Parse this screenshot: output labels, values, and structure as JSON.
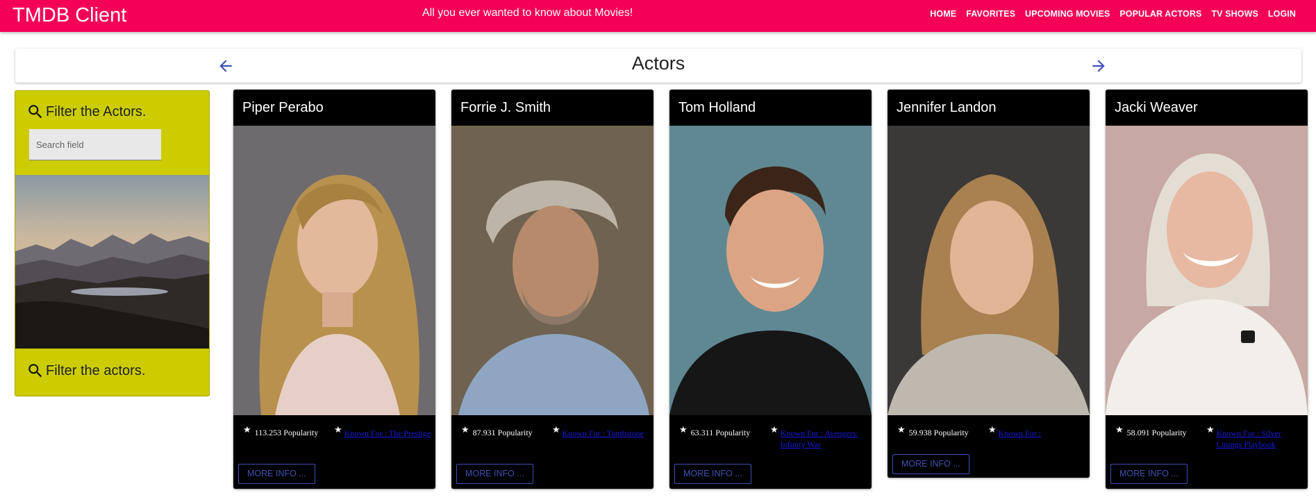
{
  "appbar": {
    "title": "TMDB Client",
    "tagline": "All you ever wanted to know about Movies!",
    "nav": [
      "HOME",
      "FAVORITES",
      "UPCOMING MOVIES",
      "POPULAR ACTORS",
      "TV SHOWS",
      "LOGIN"
    ],
    "color": "#f50057"
  },
  "header": {
    "title": "Actors",
    "prev_icon": "arrow-left-icon",
    "next_icon": "arrow-right-icon"
  },
  "filter": {
    "heading_top": "Filter the Actors.",
    "search_placeholder": "Search field",
    "heading_bottom": "Filter the actors.",
    "color": "#cccc00"
  },
  "actors": [
    {
      "name": "Piper Perabo",
      "popularity": "113.253 Popularity",
      "known_for": "Known For : The Prestige",
      "more": "MORE INFO ..."
    },
    {
      "name": "Forrie J. Smith",
      "popularity": "87.931 Popularity",
      "known_for": "Known For : Tombstone",
      "more": "MORE INFO ..."
    },
    {
      "name": "Tom Holland",
      "popularity": "63.311 Popularity",
      "known_for": "Known For : Avengers: Infinity War",
      "more": "MORE INFO ..."
    },
    {
      "name": "Jennifer Landon",
      "popularity": "59.938 Popularity",
      "known_for": "Known For :",
      "more": "MORE INFO ..."
    },
    {
      "name": "Jacki Weaver",
      "popularity": "58.091 Popularity",
      "known_for": "Known For : Silver Linings Playbook",
      "more": "MORE INFO ..."
    }
  ]
}
